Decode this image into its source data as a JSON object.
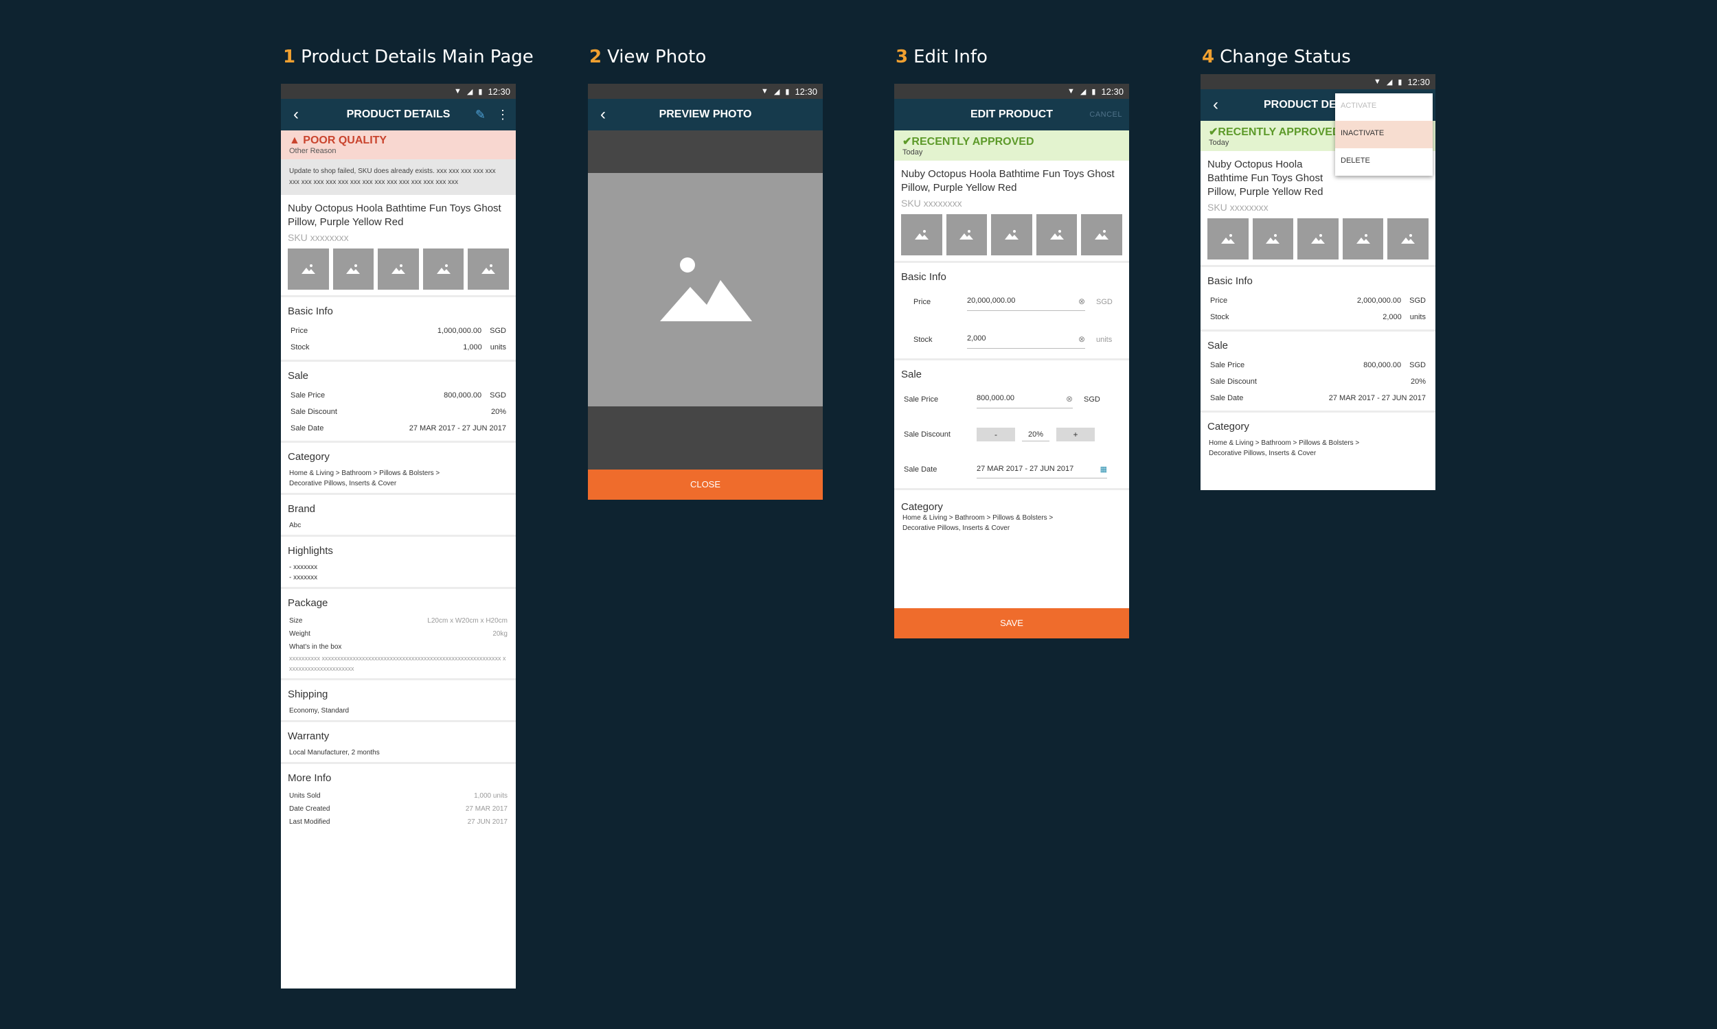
{
  "status_time": "12:30",
  "titles": [
    {
      "num": "1",
      "label": "Product Details Main Page"
    },
    {
      "num": "2",
      "label": "View Photo"
    },
    {
      "num": "3",
      "label": "Edit Info"
    },
    {
      "num": "4",
      "label": "Change Status"
    }
  ],
  "colors": {
    "background": "#0e2330",
    "appbar": "#163a4c",
    "accent": "#ef6c2c",
    "warn": "#c9442e",
    "ok": "#5d9a2a"
  },
  "product": {
    "name": "Nuby Octopus Hoola Bathtime Fun Toys Ghost Pillow, Purple Yellow Red",
    "sku": "SKU xxxxxxxx"
  },
  "screen1": {
    "appbar_title": "PRODUCT DETAILS",
    "warn_title": "POOR QUALITY",
    "warn_sub": "Other Reason",
    "warn_msg": "Update to shop failed, SKU does already exists. xxx xxx xxx xxx xxx xxx xxx xxx xxx xxx xxx xxx xxx xxx xxx xxx xxx xxx xxx",
    "basic_info": "Basic Info",
    "price_label": "Price",
    "price_value": "1,000,000.00",
    "price_unit": "SGD",
    "stock_label": "Stock",
    "stock_value": "1,000",
    "stock_unit": "units",
    "sale": "Sale",
    "sale_price_label": "Sale Price",
    "sale_price_value": "800,000.00",
    "sale_price_unit": "SGD",
    "sale_discount_label": "Sale Discount",
    "sale_discount_value": "20%",
    "sale_date_label": "Sale Date",
    "sale_date_value": "27 MAR 2017 - 27 JUN 2017",
    "category": "Category",
    "category_value": "Home & Living > Bathroom > Pillows & Bolsters > Decorative Pillows, Inserts & Cover",
    "brand": "Brand",
    "brand_value": "Abc",
    "highlights": "Highlights",
    "highlight_1": "- xxxxxxx",
    "highlight_2": "- xxxxxxx",
    "package": "Package",
    "size_label": "Size",
    "size_value": "L20cm x W20cm x H20cm",
    "weight_label": "Weight",
    "weight_value": "20kg",
    "box_label": "What's in the box",
    "box_value": "xxxxxxxxxx xxxxxxxxxxxxxxxxxxxxxxxxxxxxxxxxxxxxxxxxxxxxxxxxxxxxxxxxxx xxxxxxxxxxxxxxxxxxxxxx",
    "shipping": "Shipping",
    "shipping_value": "Economy, Standard",
    "warranty": "Warranty",
    "warranty_value": "Local Manufacturer, 2 months",
    "more_info": "More Info",
    "units_sold_label": "Units Sold",
    "units_sold_value": "1,000 units",
    "date_created_label": "Date Created",
    "date_created_value": "27 MAR 2017",
    "last_modified_label": "Last Modified",
    "last_modified_value": "27 JUN 2017"
  },
  "screen2": {
    "appbar_title": "PREVIEW PHOTO",
    "close_label": "CLOSE"
  },
  "screen3": {
    "appbar_title": "EDIT PRODUCT",
    "cancel_label": "CANCEL",
    "ok_title": "RECENTLY APPROVED",
    "ok_sub": "Today",
    "basic_info": "Basic Info",
    "price_label": "Price",
    "price_value": "20,000,000.00",
    "price_unit": "SGD",
    "stock_label": "Stock",
    "stock_value": "2,000",
    "stock_unit": "units",
    "sale": "Sale",
    "sale_price_label": "Sale Price",
    "sale_price_value": "800,000.00",
    "sale_price_unit": "SGD",
    "sale_discount_label": "Sale Discount",
    "minus": "-",
    "discount_value": "20%",
    "plus": "+",
    "sale_date_label": "Sale Date",
    "sale_date_value": "27 MAR 2017 - 27 JUN 2017",
    "category": "Category",
    "category_value": "Home & Living > Bathroom > Pillows & Bolsters > Decorative Pillows, Inserts & Cover",
    "save_label": "SAVE"
  },
  "screen4": {
    "appbar_title": "PRODUCT DE",
    "ok_title": "RECENTLY APPROVED",
    "ok_sub": "Today",
    "menu": [
      "ACTIVATE",
      "INACTIVATE",
      "DELETE"
    ],
    "basic_info": "Basic Info",
    "price_label": "Price",
    "price_value": "2,000,000.00",
    "price_unit": "SGD",
    "stock_label": "Stock",
    "stock_value": "2,000",
    "stock_unit": "units",
    "sale": "Sale",
    "sale_price_label": "Sale Price",
    "sale_price_value": "800,000.00",
    "sale_price_unit": "SGD",
    "sale_discount_label": "Sale Discount",
    "sale_discount_value": "20%",
    "sale_date_label": "Sale Date",
    "sale_date_value": "27 MAR 2017 - 27 JUN 2017",
    "category": "Category",
    "category_value": "Home & Living > Bathroom > Pillows & Bolsters > Decorative Pillows, Inserts & Cover"
  }
}
